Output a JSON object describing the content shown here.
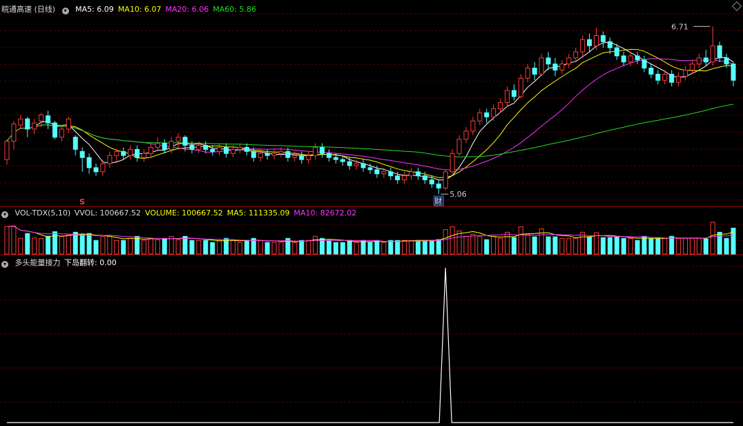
{
  "main_chart": {
    "title": "皖通高速 (日线)",
    "indicators": [
      {
        "label": "MA5: 6.09",
        "color": "#ffffff"
      },
      {
        "label": "MA10: 6.07",
        "color": "#ffff00"
      },
      {
        "label": "MA20: 6.06",
        "color": "#ff33ff"
      },
      {
        "label": "MA60: 5.86",
        "color": "#22dd22"
      }
    ],
    "high_label": "6.71",
    "low_label": "5.06",
    "marker_s": "S",
    "marker_cai": "财"
  },
  "volume_chart": {
    "title": "VOL-TDX(5,10)",
    "indicators": [
      {
        "label": "VVOL: 100667.52",
        "color": "#dddddd"
      },
      {
        "label": "VOLUME: 100667.52",
        "color": "#ffff00"
      },
      {
        "label": "MA5: 111335.09",
        "color": "#ffff00"
      },
      {
        "label": "MA10: 82672.02",
        "color": "#ff33ff"
      }
    ]
  },
  "signal_chart": {
    "title": "多头能量接力",
    "indicators": [
      {
        "label": "下岛翻转: 0.00",
        "color": "#ffffff"
      }
    ]
  },
  "chart_data": {
    "type": "candlestick",
    "ylim": [
      5.0,
      6.8
    ],
    "candles": [
      [
        5.4,
        5.58,
        5.6,
        5.35
      ],
      [
        5.58,
        5.75,
        5.78,
        5.5
      ],
      [
        5.74,
        5.8,
        5.84,
        5.7
      ],
      [
        5.8,
        5.7,
        5.82,
        5.62
      ],
      [
        5.7,
        5.76,
        5.8,
        5.65
      ],
      [
        5.78,
        5.84,
        5.86,
        5.72
      ],
      [
        5.83,
        5.76,
        5.88,
        5.7
      ],
      [
        5.76,
        5.62,
        5.78,
        5.6
      ],
      [
        5.62,
        5.7,
        5.74,
        5.58
      ],
      [
        5.7,
        5.8,
        5.82,
        5.66
      ],
      [
        5.62,
        5.5,
        5.64,
        5.44
      ],
      [
        5.48,
        5.42,
        5.52,
        5.28
      ],
      [
        5.42,
        5.32,
        5.46,
        5.26
      ],
      [
        5.32,
        5.28,
        5.36,
        5.24
      ],
      [
        5.28,
        5.36,
        5.4,
        5.24
      ],
      [
        5.36,
        5.44,
        5.48,
        5.32
      ],
      [
        5.44,
        5.48,
        5.5,
        5.38
      ],
      [
        5.48,
        5.44,
        5.52,
        5.4
      ],
      [
        5.44,
        5.5,
        5.54,
        5.4
      ],
      [
        5.5,
        5.42,
        5.54,
        5.38
      ],
      [
        5.42,
        5.46,
        5.5,
        5.38
      ],
      [
        5.46,
        5.52,
        5.56,
        5.42
      ],
      [
        5.52,
        5.56,
        5.62,
        5.48
      ],
      [
        5.56,
        5.5,
        5.6,
        5.46
      ],
      [
        5.5,
        5.58,
        5.62,
        5.46
      ],
      [
        5.58,
        5.62,
        5.66,
        5.52
      ],
      [
        5.62,
        5.54,
        5.64,
        5.48
      ],
      [
        5.54,
        5.5,
        5.58,
        5.46
      ],
      [
        5.5,
        5.54,
        5.58,
        5.46
      ],
      [
        5.54,
        5.5,
        5.58,
        5.46
      ],
      [
        5.5,
        5.48,
        5.54,
        5.44
      ],
      [
        5.48,
        5.52,
        5.56,
        5.44
      ],
      [
        5.52,
        5.46,
        5.56,
        5.42
      ],
      [
        5.46,
        5.5,
        5.54,
        5.42
      ],
      [
        5.5,
        5.52,
        5.56,
        5.46
      ],
      [
        5.52,
        5.48,
        5.56,
        5.44
      ],
      [
        5.48,
        5.42,
        5.52,
        5.38
      ],
      [
        5.42,
        5.46,
        5.5,
        5.38
      ],
      [
        5.46,
        5.44,
        5.5,
        5.4
      ],
      [
        5.44,
        5.46,
        5.5,
        5.4
      ],
      [
        5.46,
        5.48,
        5.52,
        5.42
      ],
      [
        5.48,
        5.42,
        5.52,
        5.38
      ],
      [
        5.42,
        5.44,
        5.48,
        5.38
      ],
      [
        5.44,
        5.4,
        5.48,
        5.36
      ],
      [
        5.4,
        5.44,
        5.48,
        5.36
      ],
      [
        5.44,
        5.52,
        5.56,
        5.4
      ],
      [
        5.52,
        5.46,
        5.56,
        5.42
      ],
      [
        5.46,
        5.42,
        5.5,
        5.38
      ],
      [
        5.42,
        5.4,
        5.46,
        5.36
      ],
      [
        5.4,
        5.38,
        5.44,
        5.34
      ],
      [
        5.38,
        5.34,
        5.42,
        5.3
      ],
      [
        5.34,
        5.36,
        5.4,
        5.3
      ],
      [
        5.36,
        5.32,
        5.4,
        5.28
      ],
      [
        5.32,
        5.3,
        5.36,
        5.26
      ],
      [
        5.3,
        5.26,
        5.34,
        5.22
      ],
      [
        5.26,
        5.28,
        5.32,
        5.22
      ],
      [
        5.28,
        5.24,
        5.32,
        5.2
      ],
      [
        5.24,
        5.2,
        5.28,
        5.16
      ],
      [
        5.2,
        5.24,
        5.28,
        5.16
      ],
      [
        5.24,
        5.28,
        5.32,
        5.2
      ],
      [
        5.28,
        5.24,
        5.32,
        5.2
      ],
      [
        5.24,
        5.2,
        5.28,
        5.16
      ],
      [
        5.2,
        5.16,
        5.24,
        5.12
      ],
      [
        5.16,
        5.12,
        5.2,
        5.06
      ],
      [
        5.12,
        5.28,
        5.3,
        5.1
      ],
      [
        5.28,
        5.46,
        5.5,
        5.26
      ],
      [
        5.46,
        5.6,
        5.64,
        5.44
      ],
      [
        5.6,
        5.68,
        5.72,
        5.56
      ],
      [
        5.68,
        5.78,
        5.82,
        5.64
      ],
      [
        5.78,
        5.86,
        5.9,
        5.74
      ],
      [
        5.86,
        5.82,
        5.9,
        5.76
      ],
      [
        5.82,
        5.9,
        5.94,
        5.78
      ],
      [
        5.9,
        5.96,
        6.0,
        5.86
      ],
      [
        5.96,
        6.08,
        6.12,
        5.92
      ],
      [
        6.08,
        6.02,
        6.14,
        5.98
      ],
      [
        6.02,
        6.2,
        6.24,
        6.0
      ],
      [
        6.2,
        6.3,
        6.34,
        6.16
      ],
      [
        6.3,
        6.24,
        6.36,
        6.18
      ],
      [
        6.24,
        6.4,
        6.44,
        6.22
      ],
      [
        6.4,
        6.34,
        6.46,
        6.28
      ],
      [
        6.34,
        6.28,
        6.4,
        6.22
      ],
      [
        6.28,
        6.34,
        6.38,
        6.24
      ],
      [
        6.34,
        6.4,
        6.44,
        6.3
      ],
      [
        6.4,
        6.46,
        6.5,
        6.36
      ],
      [
        6.46,
        6.58,
        6.62,
        6.42
      ],
      [
        6.58,
        6.52,
        6.64,
        6.46
      ],
      [
        6.52,
        6.62,
        6.7,
        6.48
      ],
      [
        6.62,
        6.56,
        6.66,
        6.5
      ],
      [
        6.56,
        6.5,
        6.6,
        6.44
      ],
      [
        6.5,
        6.42,
        6.54,
        6.38
      ],
      [
        6.42,
        6.36,
        6.46,
        6.32
      ],
      [
        6.36,
        6.42,
        6.46,
        6.32
      ],
      [
        6.42,
        6.38,
        6.46,
        6.34
      ],
      [
        6.38,
        6.3,
        6.42,
        6.26
      ],
      [
        6.3,
        6.24,
        6.34,
        6.2
      ],
      [
        6.24,
        6.18,
        6.28,
        6.14
      ],
      [
        6.18,
        6.24,
        6.28,
        6.14
      ],
      [
        6.24,
        6.16,
        6.28,
        6.12
      ],
      [
        6.16,
        6.22,
        6.26,
        6.12
      ],
      [
        6.22,
        6.28,
        6.32,
        6.18
      ],
      [
        6.28,
        6.34,
        6.38,
        6.24
      ],
      [
        6.34,
        6.4,
        6.44,
        6.3
      ],
      [
        6.4,
        6.36,
        6.48,
        6.32
      ],
      [
        6.36,
        6.52,
        6.71,
        6.32
      ],
      [
        6.52,
        6.4,
        6.56,
        6.36
      ],
      [
        6.4,
        6.34,
        6.44,
        6.3
      ],
      [
        6.34,
        6.18,
        6.36,
        6.12
      ]
    ],
    "signal_peak_index": 64
  }
}
